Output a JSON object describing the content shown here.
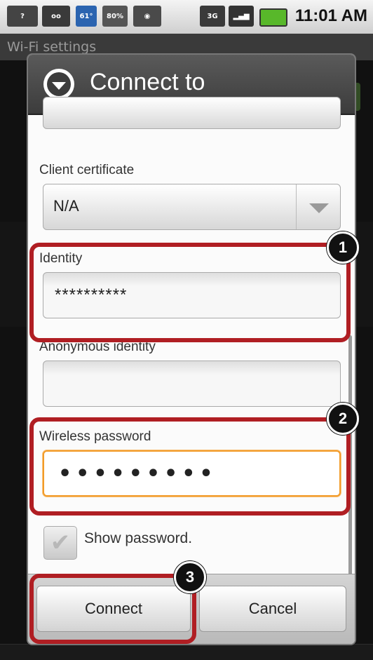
{
  "status_bar": {
    "time": "11:01 AM",
    "network_label": "3G",
    "notification_badge": "61°",
    "battery_label": "80%"
  },
  "background": {
    "title": "Wi-Fi settings"
  },
  "dialog": {
    "title": "Connect to",
    "client_certificate_label": "Client certificate",
    "client_certificate_value": "N/A",
    "identity_label": "Identity",
    "identity_value": "**********",
    "anonymous_identity_label": "Anonymous identity",
    "anonymous_identity_value": "",
    "wireless_password_label": "Wireless password",
    "wireless_password_value": "•••••••••",
    "show_password_label": "Show password.",
    "connect_label": "Connect",
    "cancel_label": "Cancel"
  },
  "annotations": {
    "step1": "1",
    "step2": "2",
    "step3": "3"
  },
  "colors": {
    "annotation_red": "#b01e23",
    "focus_orange": "#f29b28",
    "header_dark": "#3c3c3c"
  }
}
